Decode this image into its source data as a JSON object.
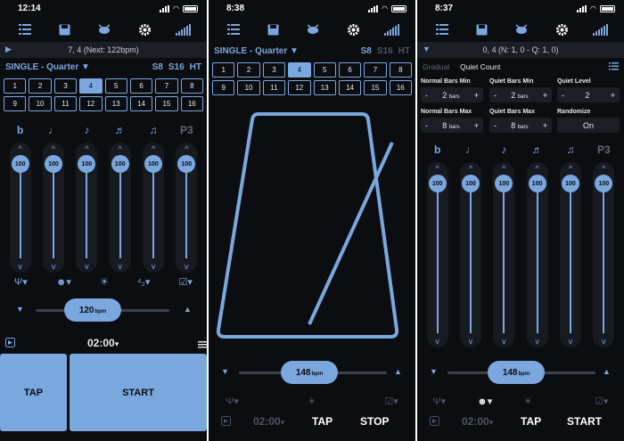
{
  "screens": [
    {
      "status_time": "12:14",
      "info_text": "7, 4 (Next: 122bpm)",
      "pattern_label": "SINGLE - Quarter ▼",
      "pattern_opts": [
        "S8",
        "S16",
        "HT"
      ],
      "cells": [
        "1",
        "2",
        "3",
        "4",
        "5",
        "6",
        "7",
        "8",
        "9",
        "10",
        "11",
        "12",
        "13",
        "14",
        "15",
        "16"
      ],
      "selected_cell": "4",
      "sliders": [
        {
          "icon": "b",
          "value": "100",
          "up": "^",
          "down": "v"
        },
        {
          "icon": "♩",
          "value": "100",
          "up": "^",
          "down": "v"
        },
        {
          "icon": "♪",
          "value": "100",
          "up": "^",
          "down": "v"
        },
        {
          "icon": "♬",
          "value": "100",
          "up": "^",
          "down": "v"
        },
        {
          "icon": "♫",
          "value": "100",
          "up": "^",
          "down": "v"
        },
        {
          "icon": "P3",
          "value": "100",
          "up": "^",
          "down": "v"
        }
      ],
      "icon_row": [
        "Ψ▾",
        "☻▾",
        "☀",
        "⁴₂▾",
        "☑▾"
      ],
      "tempo_value": "120",
      "tempo_unit": "bpm",
      "tempo_down": "▼",
      "tempo_up": "▲",
      "timer": "02:00",
      "timer_caret": "▾",
      "tap_label": "TAP",
      "start_label": "START"
    },
    {
      "status_time": "8:38",
      "info_text": "",
      "pattern_label": "SINGLE - Quarter ▼",
      "pattern_opts": [
        "S8",
        "S16",
        "HT"
      ],
      "cells": [
        "1",
        "2",
        "3",
        "4",
        "5",
        "6",
        "7",
        "8",
        "9",
        "10",
        "11",
        "12",
        "13",
        "14",
        "15",
        "16"
      ],
      "selected_cell": "4",
      "tempo_value": "148",
      "tempo_unit": "bpm",
      "tempo_down": "▼",
      "tempo_up": "▲",
      "icon_row": [
        "Ψ▾",
        "",
        "☀",
        "",
        "☑▾"
      ],
      "timer": "02:00",
      "timer_caret": "▾",
      "tap_label": "TAP",
      "stop_label": "STOP"
    },
    {
      "status_time": "8:37",
      "info_text": "0, 4 (N: 1, 0 - Q: 1, 0)",
      "tab_gradual": "Gradual",
      "tab_quiet": "Quiet Count",
      "quiet": [
        {
          "label": "Normal Bars Min",
          "minus": "-",
          "value": "2",
          "unit": "bars",
          "plus": "+"
        },
        {
          "label": "Quiet Bars Min",
          "minus": "-",
          "value": "2",
          "unit": "bars",
          "plus": "+"
        },
        {
          "label": "Quiet Level",
          "minus": "-",
          "value": "2",
          "unit": "",
          "plus": "+"
        },
        {
          "label": "Normal Bars Max",
          "minus": "-",
          "value": "8",
          "unit": "bars",
          "plus": "+"
        },
        {
          "label": "Quiet Bars Max",
          "minus": "-",
          "value": "8",
          "unit": "bars",
          "plus": "+"
        },
        {
          "label": "Randomize",
          "minus": "",
          "value": "On",
          "unit": "",
          "plus": ""
        }
      ],
      "sliders": [
        {
          "icon": "b",
          "value": "100",
          "up": "^",
          "down": "v"
        },
        {
          "icon": "♩",
          "value": "100",
          "up": "^",
          "down": "v"
        },
        {
          "icon": "♪",
          "value": "100",
          "up": "^",
          "down": "v"
        },
        {
          "icon": "♬",
          "value": "100",
          "up": "^",
          "down": "v"
        },
        {
          "icon": "♫",
          "value": "100",
          "up": "^",
          "down": "v"
        },
        {
          "icon": "P3",
          "value": "100",
          "up": "^",
          "down": "v"
        }
      ],
      "tempo_value": "148",
      "tempo_unit": "bpm",
      "tempo_down": "▼",
      "tempo_up": "▲",
      "icon_row": [
        "Ψ▾",
        "☻▾",
        "☀",
        "",
        "☑▾"
      ],
      "timer": "02:00",
      "timer_caret": "▾",
      "tap_label": "TAP",
      "start_label": "START"
    }
  ],
  "colors": {
    "accent": "#7aa7de",
    "background": "#0b0d11",
    "panel": "#1b1e25"
  }
}
